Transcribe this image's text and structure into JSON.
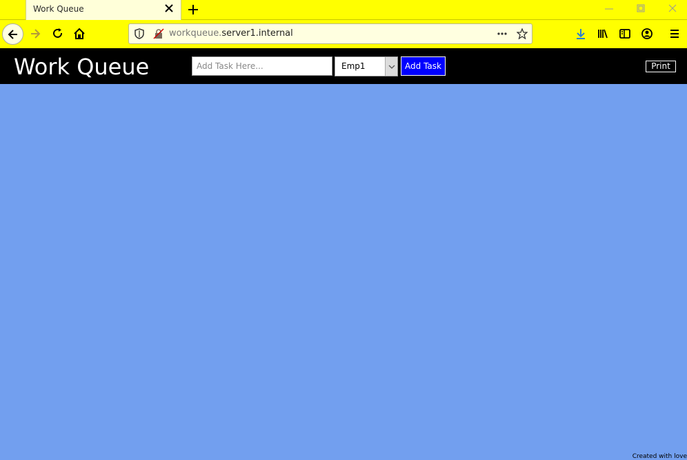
{
  "browser": {
    "tab": {
      "title": "Work Queue"
    },
    "url": {
      "host_prefix": "workqueue.",
      "host_rest": "server1.internal"
    }
  },
  "app": {
    "title": "Work Queue",
    "task_input": {
      "placeholder": "Add Task Here...",
      "value": ""
    },
    "employee_select": {
      "selected": "Emp1"
    },
    "add_button": "Add Task",
    "print_button": "Print"
  },
  "footer": {
    "text": "Created with love"
  },
  "colors": {
    "browser_chrome": "#ffff00",
    "app_bar": "#000000",
    "background": "#729fef",
    "add_button": "#0000ff"
  }
}
